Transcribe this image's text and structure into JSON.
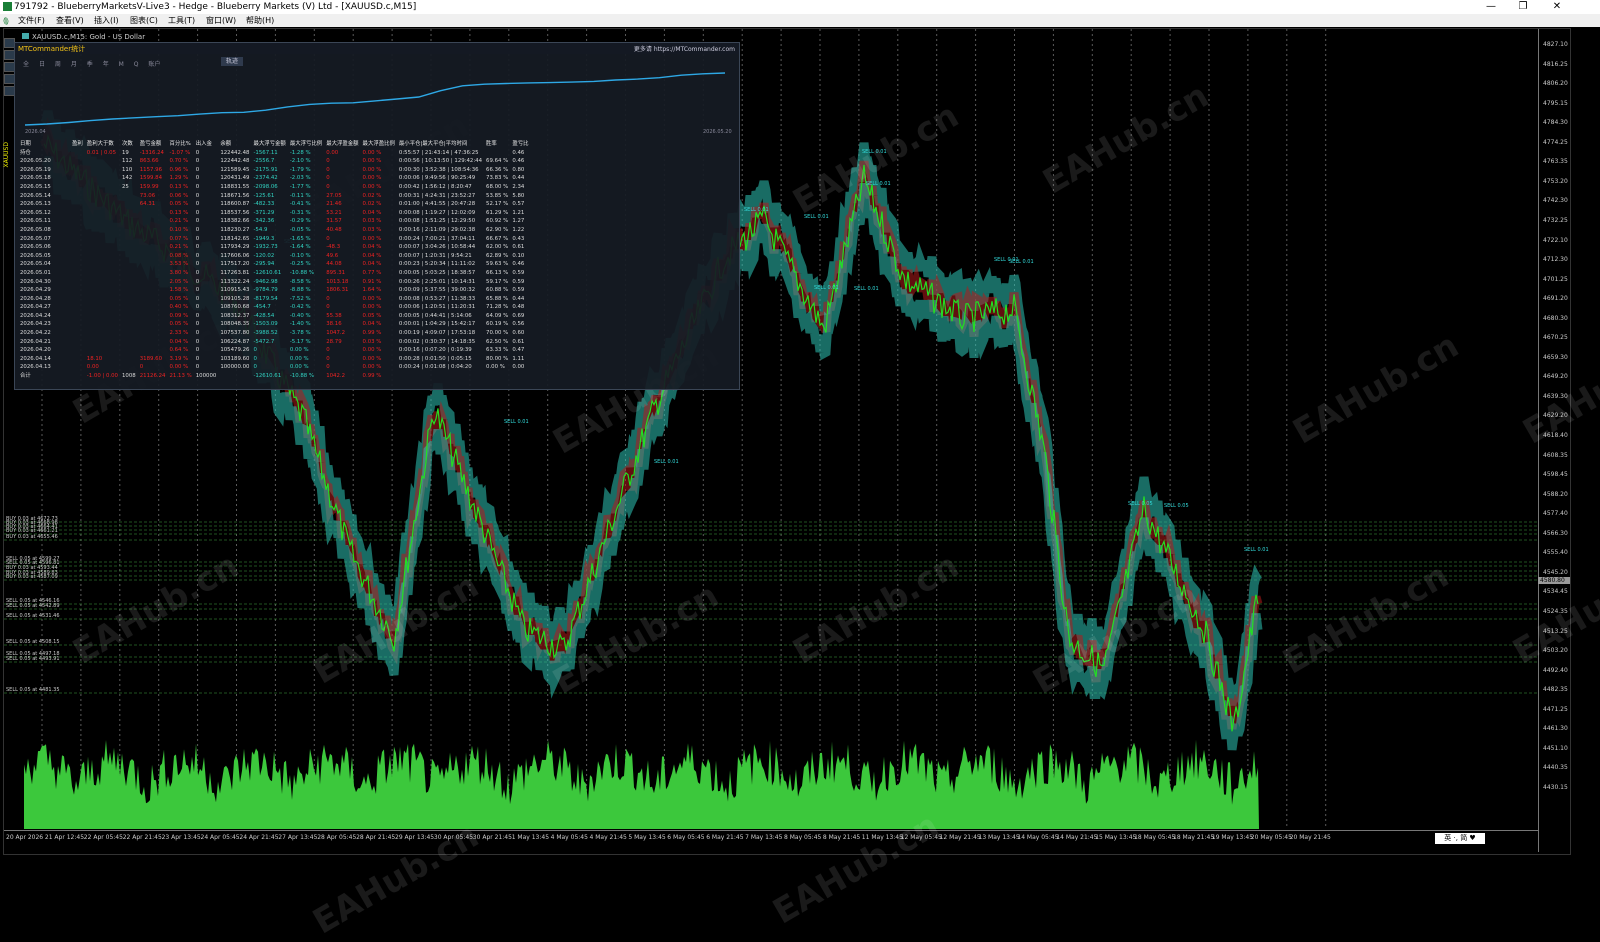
{
  "window": {
    "title": "791792 - BlueberryMarketsV-Live3 - Hedge - Blueberry Markets (V) Ltd - [XAUUSD.c,M15]",
    "controls": [
      "—",
      "❐",
      "✕"
    ]
  },
  "menu": [
    "文件(F)",
    "查看(V)",
    "插入(I)",
    "图表(C)",
    "工具(T)",
    "窗口(W)",
    "帮助(H)"
  ],
  "chart": {
    "title": "XAUUSD.c,M15: Gold - US Dollar",
    "price_ticks": [
      "4827.10",
      "4816.25",
      "4806.20",
      "4795.15",
      "4784.30",
      "4774.25",
      "4763.35",
      "4753.20",
      "4742.30",
      "4732.25",
      "4722.10",
      "4712.30",
      "4701.25",
      "4691.20",
      "4680.30",
      "4670.25",
      "4659.30",
      "4649.20",
      "4639.30",
      "4629.20",
      "4618.40",
      "4608.35",
      "4598.45",
      "4588.20",
      "4577.40",
      "4566.30",
      "4555.40",
      "4545.20",
      "4534.45",
      "4524.35",
      "4513.25",
      "4503.20",
      "4492.40",
      "4482.35",
      "4471.25",
      "4461.30",
      "4451.10",
      "4440.35",
      "4430.15"
    ],
    "time_ticks": [
      "20 Apr 2026",
      "21 Apr 12:45",
      "22 Apr 05:45",
      "22 Apr 21:45",
      "23 Apr 13:45",
      "24 Apr 05:45",
      "24 Apr 21:45",
      "27 Apr 13:45",
      "28 Apr 05:45",
      "28 Apr 21:45",
      "29 Apr 13:45",
      "30 Apr 05:45",
      "30 Apr 21:45",
      "1 May 13:45",
      "4 May 05:45",
      "4 May 21:45",
      "5 May 13:45",
      "6 May 05:45",
      "6 May 21:45",
      "7 May 13:45",
      "8 May 05:45",
      "8 May 21:45",
      "11 May 13:45",
      "12 May 05:45",
      "12 May 21:45",
      "13 May 13:45",
      "14 May 05:45",
      "14 May 21:45",
      "15 May 13:45",
      "18 May 05:45",
      "18 May 21:45",
      "19 May 13:45",
      "20 May 05:45",
      "20 May 21:45"
    ],
    "current_price": "4580.80",
    "order_levels": [
      "BUY 0.03 at 4672.73",
      "BUY 0.03 at 4668.98",
      "BUY 0.03 at 4664.41",
      "BUY 0.03 at 4661.21",
      "BUY 0.03 at 4655.46",
      "SELL 0.05 at 4599.27",
      "SELL 0.05 at 4596.81",
      "BUY 0.03 at 4593.44",
      "BUY 0.03 at 4589.83",
      "BUY 0.03 at 4587.09",
      "SELL 0.05 at 4546.16",
      "SELL 0.05 at 4542.89",
      "SELL 0.05 at 4531.46",
      "SELL 0.05 at 4508.15",
      "SELL 0.05 at 4497.18",
      "SELL 0.05 at 4493.91",
      "SELL 0.05 at 4481.35"
    ],
    "sell_tags": [
      "SELL 0.01",
      "SELL 0.01",
      "SELL 0.01",
      "SELL 0.01",
      "SELL 0.01",
      "SELL 0.01",
      "SELL 0.01",
      "SELL 0.01",
      "SELL 0.05",
      "SELL 0.05",
      "SELL 0.01",
      "SELL 0.01",
      "SELL 0.01",
      "SELL 0.01"
    ],
    "vertical_label": "XAUUSD",
    "watermark": "EAHub.cn"
  },
  "panel": {
    "title": "MTCommander统计",
    "link": "更多请 https://MTCommander.com",
    "tabs": [
      "全",
      "日",
      "周",
      "月",
      "季",
      "年",
      "M",
      "Q",
      "账户"
    ],
    "button": "轨迹",
    "equity_start": "2026.04",
    "equity_end": "2026.05.20",
    "equity_curve": [
      100000,
      100420,
      101100,
      101900,
      102600,
      103100,
      103600,
      104000,
      104700,
      105300,
      105500,
      106400,
      107800,
      108900,
      109400,
      109600,
      110400,
      111200,
      112100,
      114800,
      116900,
      117600,
      117900,
      118150,
      118300,
      118500,
      118800,
      119400,
      119800,
      120400,
      121500,
      122100,
      122442
    ],
    "headers": [
      "日期",
      "盈利",
      "盈利大于数",
      "次数",
      "盈亏金额",
      "百分比%",
      "出入金",
      "余额",
      "最大浮亏金额",
      "最大浮亏比例",
      "最大浮盈金额",
      "最大浮盈比例",
      "最小平仓|最大平仓|平均时间",
      "胜率",
      "盈亏比"
    ],
    "rows": [
      [
        "持仓",
        "",
        "0.01 | 0.05",
        "19",
        "-1316.24",
        "-1.07 %",
        "0",
        "122442.48",
        "-1567.11",
        "-1.28 %",
        "0.00",
        "0.00 %",
        "0:55:57 | 21:43:14 | 47:36:25",
        "",
        "0.46"
      ],
      [
        "2026.05.20",
        "",
        "",
        "112",
        "863.66",
        "0.70 %",
        "0",
        "122442.48",
        "-2556.7",
        "-2.10 %",
        "0",
        "0.00 %",
        "0:00:56 | 10:13:50 | 129:42:44",
        "69.64 %",
        "0.46"
      ],
      [
        "2026.05.19",
        "",
        "",
        "110",
        "1157.96",
        "0.96 %",
        "0",
        "121589.45",
        "-2175.91",
        "-1.79 %",
        "0",
        "0.00 %",
        "0:00:30 | 3:52:38 | 108:54:36",
        "66.36 %",
        "0.80"
      ],
      [
        "2026.05.18",
        "",
        "",
        "142",
        "1599.84",
        "1.29 %",
        "0",
        "120431.49",
        "-2374.42",
        "-2.03 %",
        "0",
        "0.00 %",
        "0:00:06 | 9:49:56 | 90:25:49",
        "73.83 %",
        "0.44"
      ],
      [
        "2026.05.15",
        "",
        "",
        "25",
        "159.99",
        "0.13 %",
        "0",
        "118831.55",
        "-2098.06",
        "-1.77 %",
        "0",
        "0.00 %",
        "0:00:42 | 1:56:12 | 8:20:47",
        "68.00 %",
        "2.34"
      ],
      [
        "2026.05.14",
        "",
        "",
        "",
        "73.06",
        "0.06 %",
        "0",
        "118671.56",
        "-125.61",
        "-0.11 %",
        "27.05",
        "0.02 %",
        "0:00:31 | 4:24:31 | 23:52:27",
        "53.85 %",
        "5.80"
      ],
      [
        "2026.05.13",
        "",
        "",
        "",
        "64.31",
        "0.05 %",
        "0",
        "118600.87",
        "-482.33",
        "-0.41 %",
        "21.46",
        "0.02 %",
        "0:01:00 | 4:41:55 | 20:47:28",
        "52.17 %",
        "0.57"
      ],
      [
        "2026.05.12",
        "",
        "",
        "",
        "",
        "0.13 %",
        "0",
        "118537.56",
        "-371.29",
        "-0.31 %",
        "53.21",
        "0.04 %",
        "0:00:08 | 1:19:27 | 12:02:09",
        "61.29 %",
        "1.21"
      ],
      [
        "2026.05.11",
        "",
        "",
        "",
        "",
        "0.21 %",
        "0",
        "118382.66",
        "-342.36",
        "-0.29 %",
        "31.57",
        "0.03 %",
        "0:00:08 | 1:51:25 | 12:29:50",
        "60.92 %",
        "1.27"
      ],
      [
        "2026.05.08",
        "",
        "",
        "",
        "",
        "0.10 %",
        "0",
        "118230.27",
        "-54.9",
        "-0.05 %",
        "40.48",
        "0.03 %",
        "0:00:16 | 2:11:09 | 29:02:38",
        "62.90 %",
        "1.22"
      ],
      [
        "2026.05.07",
        "",
        "",
        "",
        "",
        "0.07 %",
        "0",
        "118142.65",
        "-1949.3",
        "-1.65 %",
        "0",
        "0.00 %",
        "0:00:24 | 7:00:21 | 37:04:11",
        "66.67 %",
        "0.43"
      ],
      [
        "2026.05.06",
        "",
        "",
        "",
        "",
        "0.21 %",
        "0",
        "117934.29",
        "-1932.73",
        "-1.64 %",
        "-48.3",
        "0.04 %",
        "0:00:07 | 3:04:26 | 10:58:44",
        "62.00 %",
        "0.61"
      ],
      [
        "2026.05.05",
        "",
        "",
        "",
        "",
        "0.08 %",
        "0",
        "117606.06",
        "-120.02",
        "-0.10 %",
        "49.6",
        "0.04 %",
        "0:00:07 | 1:20:31 | 9:54:21",
        "62.89 %",
        "0.10"
      ],
      [
        "2026.05.04",
        "",
        "",
        "",
        "",
        "3.53 %",
        "0",
        "117517.20",
        "-295.94",
        "-0.25 %",
        "44.08",
        "0.04 %",
        "0:00:23 | 5:20:34 | 11:11:02",
        "59.63 %",
        "0.46"
      ],
      [
        "2026.05.01",
        "",
        "",
        "",
        "",
        "3.80 %",
        "0",
        "117263.81",
        "-12610.61",
        "-10.88 %",
        "895.31",
        "0.77 %",
        "0:00:05 | 5:03:25 | 18:38:57",
        "66.13 %",
        "0.59"
      ],
      [
        "2026.04.30",
        "",
        "",
        "",
        "",
        "2.05 %",
        "0",
        "113322.24",
        "-9462.98",
        "-8.58 %",
        "1013.18",
        "0.91 %",
        "0:00:26 | 2:25:01 | 10:14:31",
        "59.17 %",
        "0.59"
      ],
      [
        "2026.04.29",
        "",
        "",
        "",
        "",
        "1.58 %",
        "0",
        "110915.43",
        "-9784.79",
        "-8.88 %",
        "1806.31",
        "1.64 %",
        "0:00:09 | 5:37:55 | 39:00:32",
        "60.88 %",
        "0.59"
      ],
      [
        "2026.04.28",
        "",
        "",
        "",
        "",
        "0.05 %",
        "0",
        "109105.28",
        "-8179.54",
        "-7.52 %",
        "0",
        "0.00 %",
        "0:00:08 | 0:53:27 | 11:38:33",
        "65.88 %",
        "0.44"
      ],
      [
        "2026.04.27",
        "",
        "",
        "",
        "",
        "0.40 %",
        "0",
        "108760.68",
        "-454.7",
        "-0.42 %",
        "0",
        "0.00 %",
        "0:00:06 | 1:20:51 | 11:20:31",
        "71.28 %",
        "0.48"
      ],
      [
        "2026.04.24",
        "",
        "",
        "",
        "",
        "0.09 %",
        "0",
        "108312.37",
        "-428.54",
        "-0.40 %",
        "55.38",
        "0.05 %",
        "0:00:05 | 0:44:41 | 5:14:06",
        "64.09 %",
        "0.69"
      ],
      [
        "2026.04.23",
        "",
        "",
        "",
        "",
        "0.05 %",
        "0",
        "108048.35",
        "-1503.09",
        "-1.40 %",
        "38.16",
        "0.04 %",
        "0:00:01 | 1:04:29 | 15:42:17",
        "60.19 %",
        "0.56"
      ],
      [
        "2026.04.22",
        "",
        "",
        "",
        "",
        "2.33 %",
        "0",
        "107537.80",
        "-3988.52",
        "-3.78 %",
        "1047.2",
        "0.99 %",
        "0:00:19 | 4:09:07 | 17:53:18",
        "70.00 %",
        "0.60"
      ],
      [
        "2026.04.21",
        "",
        "",
        "",
        "",
        "0.04 %",
        "0",
        "106224.87",
        "-5472.7",
        "-5.17 %",
        "28.79",
        "0.03 %",
        "0:00:02 | 0:30:37 | 14:18:35",
        "62.50 %",
        "0.61"
      ],
      [
        "2026.04.20",
        "",
        "",
        "",
        "",
        "0.64 %",
        "0",
        "105479.26",
        "0",
        "0.00 %",
        "0",
        "0.00 %",
        "0:00:16 | 0:07:20 | 0:19:39",
        "63.33 %",
        "0.47"
      ],
      [
        "2026.04.14",
        "",
        "18.10",
        "",
        "3189.60",
        "3.19 %",
        "0",
        "103189.60",
        "0",
        "0.00 %",
        "0",
        "0.00 %",
        "0:00:28 | 0:01:50 | 0:05:15",
        "80.00 %",
        "1.11"
      ],
      [
        "2026.04.13",
        "",
        "0.00",
        "",
        "0",
        "0.00 %",
        "0",
        "100000.00",
        "0",
        "0.00 %",
        "0",
        "0.00 %",
        "0:00:24 | 0:01:08 | 0:04:20",
        "0.00 %",
        "0.00"
      ],
      [
        "合计",
        "",
        "-1.00 | 0.00",
        "1008",
        "21126.24",
        "21.13 %",
        "100000",
        "",
        "-12610.61",
        "-10.88 %",
        "1042.2",
        "0.99 %",
        "",
        "",
        ""
      ]
    ]
  },
  "taskbar_ime": "英 ·, 简 ♥"
}
